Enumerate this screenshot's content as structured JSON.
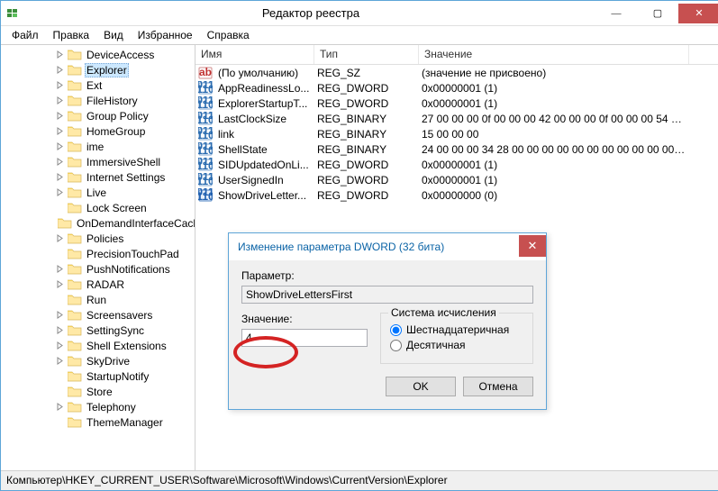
{
  "window": {
    "title": "Редактор реестра"
  },
  "menu": {
    "file": "Файл",
    "edit": "Правка",
    "view": "Вид",
    "favorites": "Избранное",
    "help": "Справка"
  },
  "tree": {
    "items": [
      {
        "name": "DeviceAccess",
        "expandable": true
      },
      {
        "name": "Explorer",
        "expandable": true,
        "selected": true
      },
      {
        "name": "Ext",
        "expandable": true
      },
      {
        "name": "FileHistory",
        "expandable": true
      },
      {
        "name": "Group Policy",
        "expandable": true
      },
      {
        "name": "HomeGroup",
        "expandable": true
      },
      {
        "name": "ime",
        "expandable": true
      },
      {
        "name": "ImmersiveShell",
        "expandable": true
      },
      {
        "name": "Internet Settings",
        "expandable": true
      },
      {
        "name": "Live",
        "expandable": true
      },
      {
        "name": "Lock Screen",
        "expandable": false
      },
      {
        "name": "OnDemandInterfaceCache",
        "expandable": false
      },
      {
        "name": "Policies",
        "expandable": true
      },
      {
        "name": "PrecisionTouchPad",
        "expandable": false
      },
      {
        "name": "PushNotifications",
        "expandable": true
      },
      {
        "name": "RADAR",
        "expandable": true
      },
      {
        "name": "Run",
        "expandable": false
      },
      {
        "name": "Screensavers",
        "expandable": true
      },
      {
        "name": "SettingSync",
        "expandable": true
      },
      {
        "name": "Shell Extensions",
        "expandable": true
      },
      {
        "name": "SkyDrive",
        "expandable": true
      },
      {
        "name": "StartupNotify",
        "expandable": false
      },
      {
        "name": "Store",
        "expandable": false
      },
      {
        "name": "Telephony",
        "expandable": true
      },
      {
        "name": "ThemeManager",
        "expandable": false
      }
    ]
  },
  "list": {
    "headers": {
      "name": "Имя",
      "type": "Тип",
      "value": "Значение"
    },
    "colw": {
      "name": 132,
      "type": 116,
      "value": 300
    },
    "rows": [
      {
        "icon": "str",
        "name": "(По умолчанию)",
        "type": "REG_SZ",
        "value": "(значение не присвоено)"
      },
      {
        "icon": "bin",
        "name": "AppReadinessLo...",
        "type": "REG_DWORD",
        "value": "0x00000001 (1)"
      },
      {
        "icon": "bin",
        "name": "ExplorerStartupT...",
        "type": "REG_DWORD",
        "value": "0x00000001 (1)"
      },
      {
        "icon": "bin",
        "name": "LastClockSize",
        "type": "REG_BINARY",
        "value": "27 00 00 00 0f 00 00 00 42 00 00 00 0f 00 00 00 54 00 ..."
      },
      {
        "icon": "bin",
        "name": "link",
        "type": "REG_BINARY",
        "value": "15 00 00 00"
      },
      {
        "icon": "bin",
        "name": "ShellState",
        "type": "REG_BINARY",
        "value": "24 00 00 00 34 28 00 00 00 00 00 00 00 00 00 00 00 00 ..."
      },
      {
        "icon": "bin",
        "name": "SIDUpdatedOnLi...",
        "type": "REG_DWORD",
        "value": "0x00000001 (1)"
      },
      {
        "icon": "bin",
        "name": "UserSignedIn",
        "type": "REG_DWORD",
        "value": "0x00000001 (1)"
      },
      {
        "icon": "bin2",
        "name": "ShowDriveLetter...",
        "type": "REG_DWORD",
        "value": "0x00000000 (0)"
      }
    ]
  },
  "status": {
    "path": "Компьютер\\HKEY_CURRENT_USER\\Software\\Microsoft\\Windows\\CurrentVersion\\Explorer"
  },
  "dialog": {
    "title": "Изменение параметра DWORD (32 бита)",
    "param_label": "Параметр:",
    "param_value": "ShowDriveLettersFirst",
    "value_label": "Значение:",
    "value_value": "4",
    "base_group": "Система исчисления",
    "radio_hex": "Шестнадцатеричная",
    "radio_dec": "Десятичная",
    "ok": "OK",
    "cancel": "Отмена"
  }
}
